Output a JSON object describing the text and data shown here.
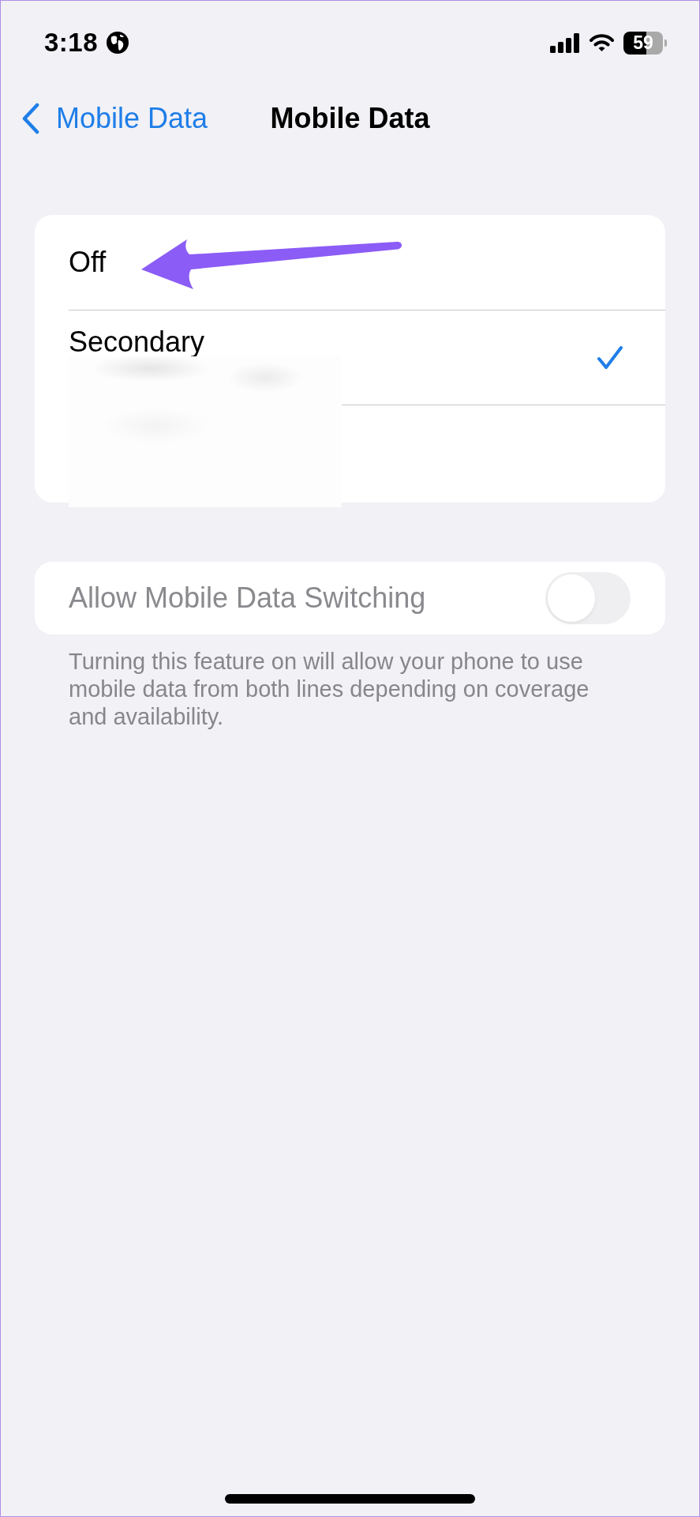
{
  "status_bar": {
    "time": "3:18",
    "battery": "59"
  },
  "nav_bar": {
    "back_label": "Mobile Data",
    "title": "Mobile Data"
  },
  "options": [
    {
      "kind": "single_line",
      "label": "Off",
      "selected": false
    },
    {
      "kind": "blurred_detail",
      "label": "Secondary",
      "selected": true
    }
  ],
  "switching": {
    "label": "Allow Mobile Data Switching",
    "on": false,
    "disabled": true
  },
  "footer": "Turning this feature on will allow your phone to use mobile data from both lines depending on coverage and availability."
}
